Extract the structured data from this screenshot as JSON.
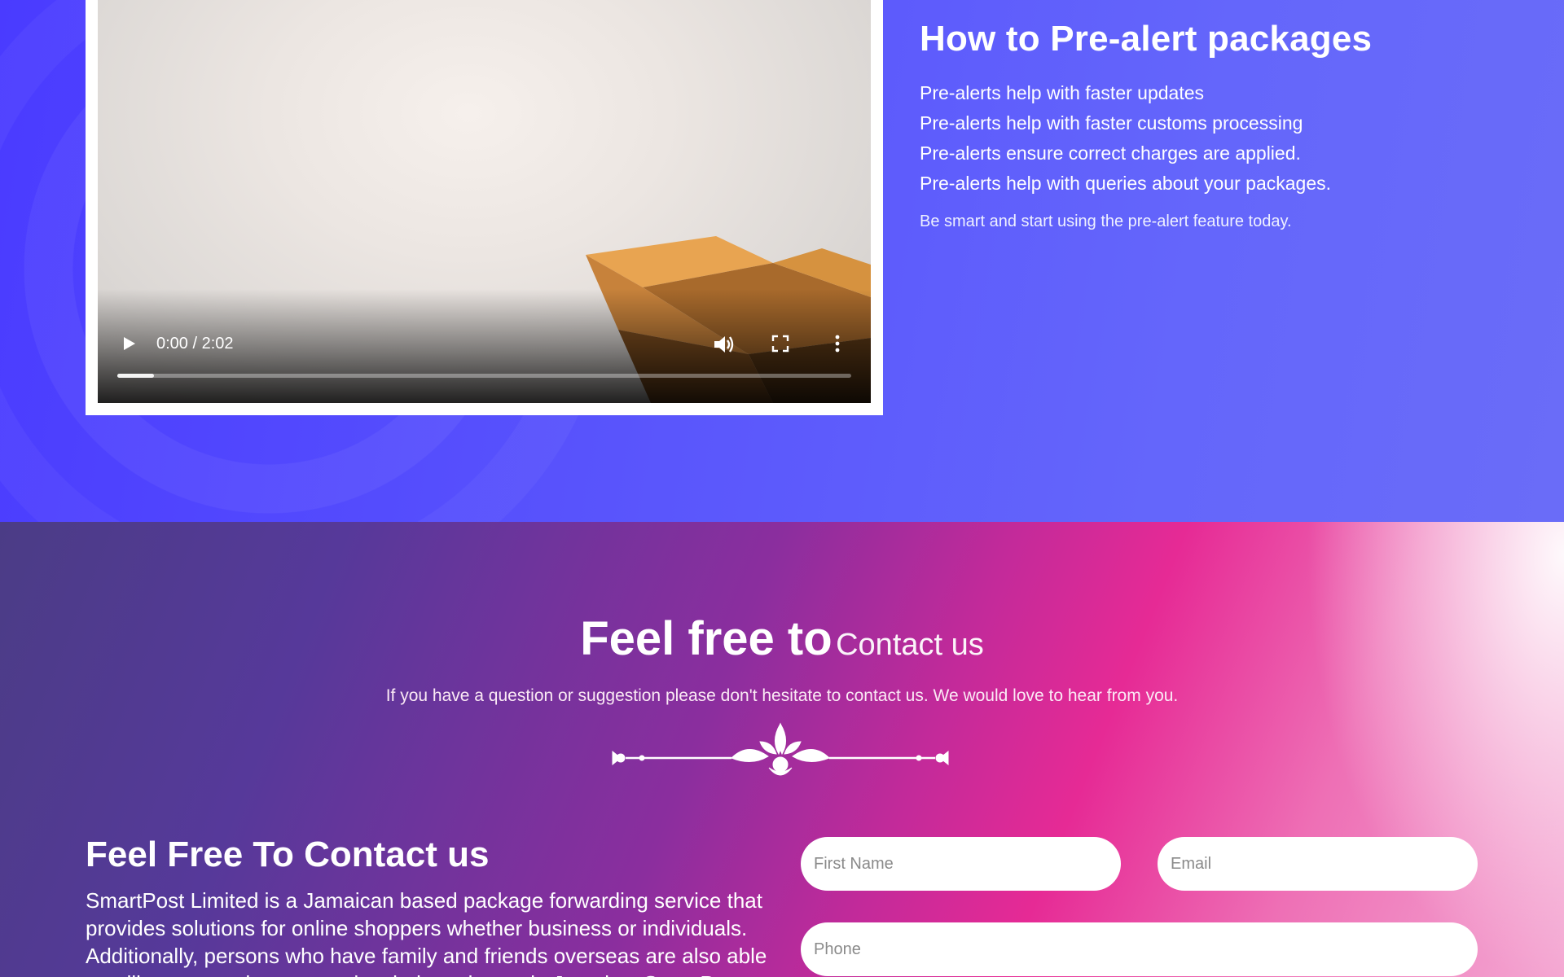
{
  "video": {
    "time": "0:00 / 2:02",
    "progress_fraction": 0.05
  },
  "prealert": {
    "title": "How to Pre-alert packages",
    "items": [
      "Pre-alerts help with faster updates",
      "Pre-alerts help with faster customs processing",
      "Pre-alerts ensure correct charges are applied.",
      "Pre-alerts help with queries about your packages."
    ],
    "note": "Be smart and start using the pre-alert feature today."
  },
  "contact": {
    "heading_bold": "Feel free to",
    "heading_light": "Contact us",
    "subtitle": "If you have a question or suggestion please don't hesitate to contact us. We would love to hear from you.",
    "left_title": "Feel Free To Contact us",
    "left_text": "SmartPost Limited is a Jamaican based package forwarding service that provides solutions for online shoppers whether business or individuals. Additionally, persons who have family and friends overseas are also able to utilize our services to receive their packages in Jamaica. SmartPost takes",
    "form": {
      "first_name_placeholder": "First Name",
      "email_placeholder": "Email",
      "phone_placeholder": "Phone"
    }
  },
  "colors": {
    "top_bg": "#5a56fc",
    "contact_start": "#4b3c86",
    "contact_pink": "#e62a95"
  },
  "icons": [
    "play-icon",
    "volume-icon",
    "fullscreen-icon",
    "more-vertical-icon",
    "ornament-divider"
  ]
}
